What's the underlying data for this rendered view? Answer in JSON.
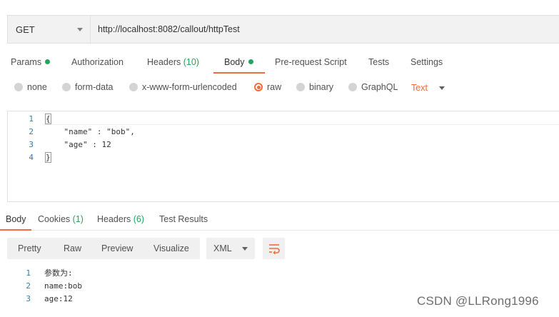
{
  "request": {
    "method": "GET",
    "url": "http://localhost:8082/callout/httpTest"
  },
  "request_tabs": {
    "params": "Params",
    "authorization": "Authorization",
    "headers": "Headers",
    "headers_count": "(10)",
    "body": "Body",
    "prerequest": "Pre-request Script",
    "tests": "Tests",
    "settings": "Settings"
  },
  "body_types": {
    "none": "none",
    "form_data": "form-data",
    "urlencoded": "x-www-form-urlencoded",
    "raw": "raw",
    "binary": "binary",
    "graphql": "GraphQL",
    "selected": "raw",
    "language": "Text"
  },
  "editor": {
    "lines": [
      {
        "num": "1",
        "text": "{"
      },
      {
        "num": "2",
        "text": "    \"name\" : \"bob\","
      },
      {
        "num": "3",
        "text": "    \"age\" : 12"
      },
      {
        "num": "4",
        "text": "}"
      }
    ]
  },
  "response_tabs": {
    "body": "Body",
    "cookies": "Cookies",
    "cookies_count": "(1)",
    "headers": "Headers",
    "headers_count": "(6)",
    "test_results": "Test Results"
  },
  "view_modes": {
    "pretty": "Pretty",
    "raw": "Raw",
    "preview": "Preview",
    "visualize": "Visualize",
    "format": "XML"
  },
  "response": {
    "lines": [
      {
        "num": "1",
        "text": "参数为:"
      },
      {
        "num": "2",
        "text": "name:bob"
      },
      {
        "num": "3",
        "text": "age:12"
      }
    ]
  },
  "watermark": "CSDN @LLRong1996",
  "colors": {
    "accent": "#f26b3a",
    "indicator": "#26a35b",
    "line_number": "#2e7cb8"
  },
  "icons": {
    "method_dropdown": "chevron-down-icon",
    "wrap": "wrap-lines-icon"
  }
}
